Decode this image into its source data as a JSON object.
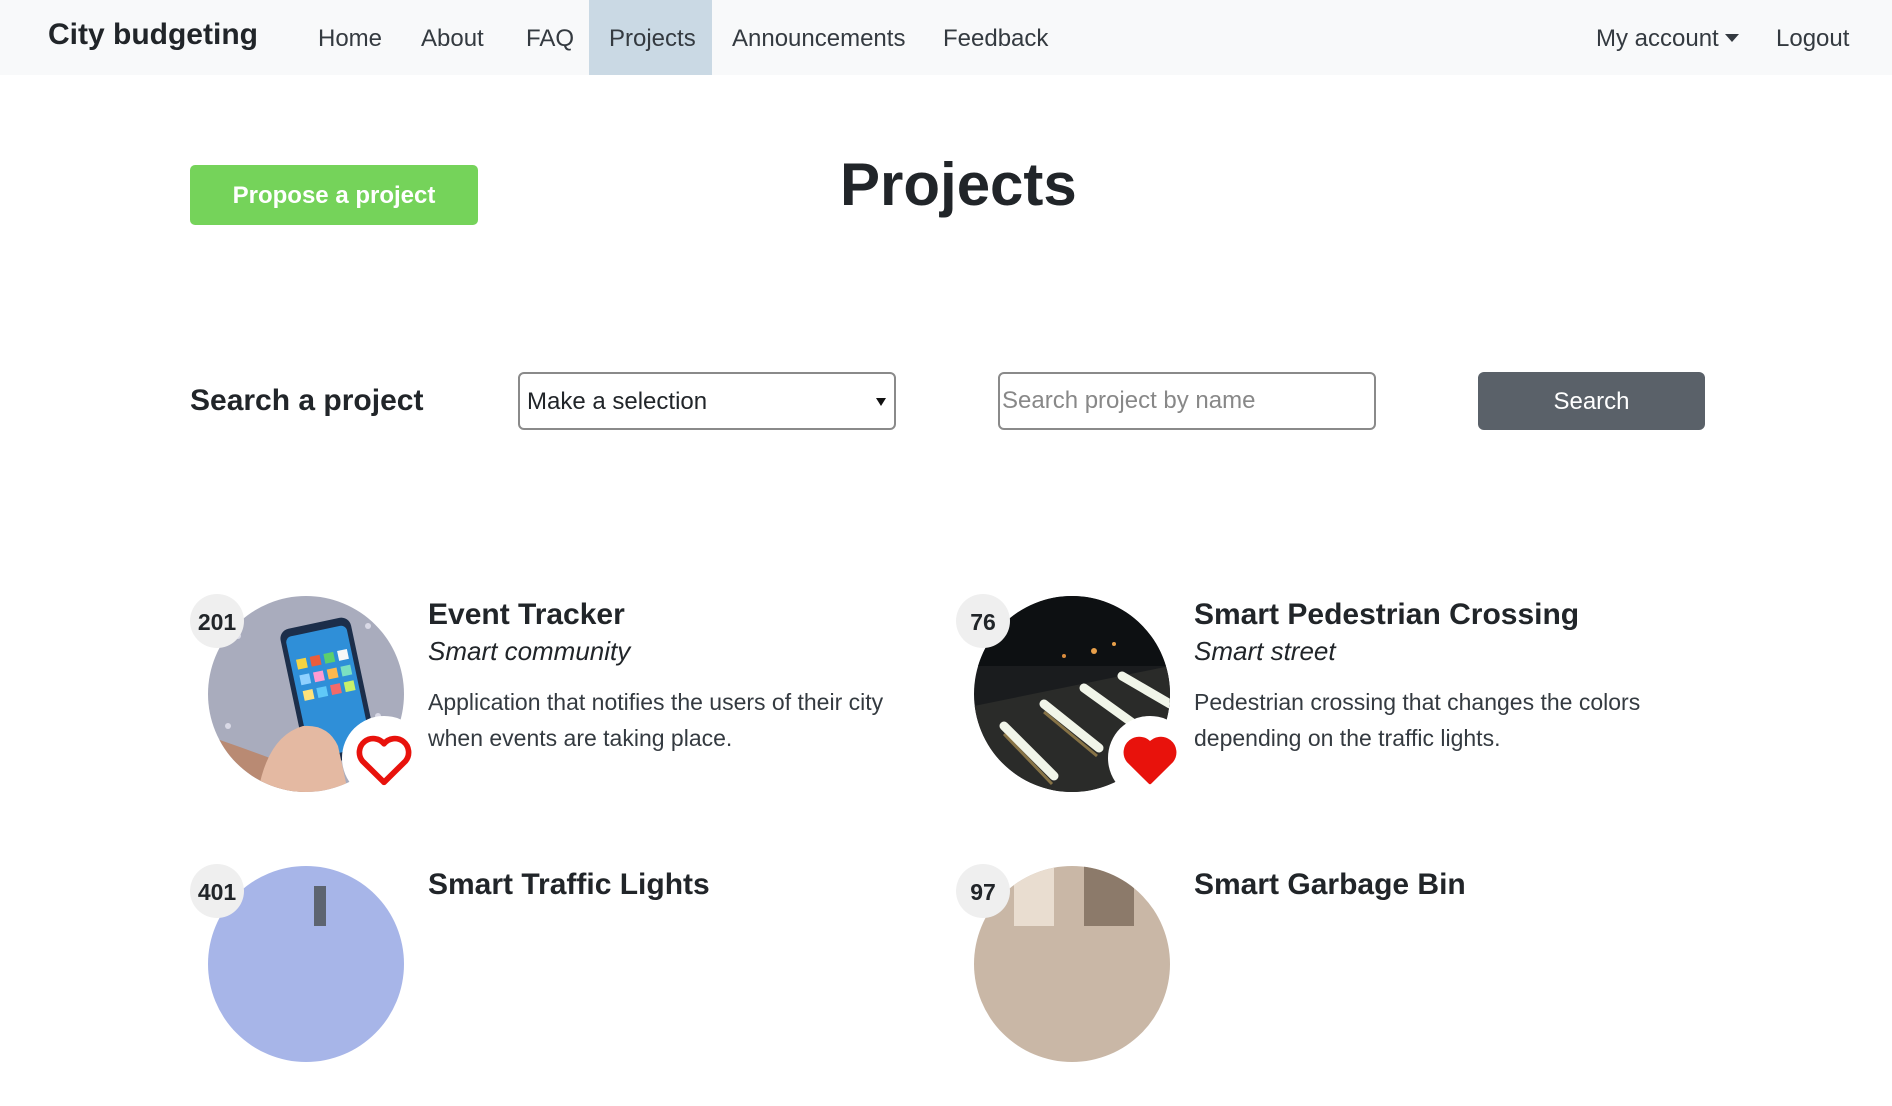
{
  "navbar": {
    "brand": "City budgeting",
    "items": [
      {
        "label": "Home"
      },
      {
        "label": "About"
      },
      {
        "label": "FAQ"
      },
      {
        "label": "Projects"
      },
      {
        "label": "Announcements"
      },
      {
        "label": "Feedback"
      }
    ],
    "account": "My account",
    "logout": "Logout"
  },
  "header": {
    "propose_label": "Propose a project",
    "title": "Projects"
  },
  "search": {
    "label": "Search a project",
    "select_value": "Make a selection",
    "placeholder": "Search project by name",
    "button_label": "Search"
  },
  "projects": [
    {
      "count": "201",
      "title": "Event Tracker",
      "category": "Smart community",
      "description": "Application that notifies the users of their city when events are taking place.",
      "liked": false,
      "image": "phone-in-hand-image"
    },
    {
      "count": "76",
      "title": "Smart Pedestrian Crossing",
      "category": "Smart street",
      "description": "Pedestrian crossing that changes the colors depending on the traffic lights.",
      "liked": true,
      "image": "lit-crosswalk-image"
    },
    {
      "count": "401",
      "title": "Smart Traffic Lights",
      "category": "",
      "description": "",
      "liked": false,
      "image": "traffic-light-image"
    },
    {
      "count": "97",
      "title": "Smart Garbage Bin",
      "category": "",
      "description": "",
      "liked": false,
      "image": "garbage-bin-image"
    }
  ],
  "colors": {
    "navbar_bg": "#f8f9fa",
    "active_tab": "#cad9e4",
    "propose_green": "#75d35a",
    "search_button": "#5a6169",
    "heart_red": "#e8120c"
  }
}
